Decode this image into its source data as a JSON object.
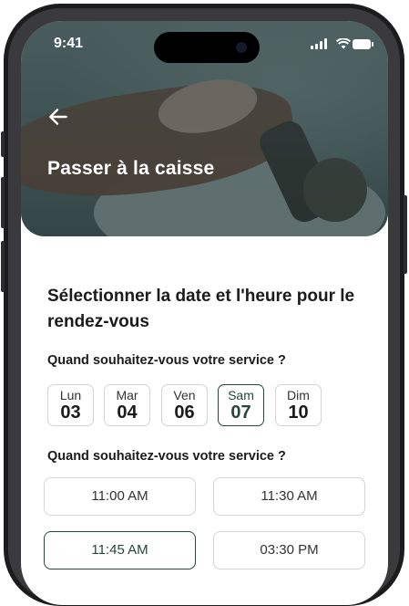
{
  "status_bar": {
    "time": "9:41"
  },
  "header": {
    "title": "Passer à la caisse"
  },
  "main": {
    "title": "Sélectionner la date et l'heure pour le rendez-vous",
    "date_question": "Quand souhaitez-vous votre service ?",
    "days": [
      {
        "name": "Lun",
        "num": "03",
        "selected": false
      },
      {
        "name": "Mar",
        "num": "04",
        "selected": false
      },
      {
        "name": "Ven",
        "num": "06",
        "selected": false
      },
      {
        "name": "Sam",
        "num": "07",
        "selected": true
      },
      {
        "name": "Dim",
        "num": "10",
        "selected": false
      }
    ],
    "time_question": "Quand souhaitez-vous votre service ?",
    "slots": [
      {
        "label": "11:00 AM",
        "selected": false
      },
      {
        "label": "11:30 AM",
        "selected": false
      },
      {
        "label": "11:45 AM",
        "selected": true
      },
      {
        "label": "03:30 PM",
        "selected": false
      }
    ]
  },
  "colors": {
    "accent": "#23473a",
    "border": "#d4d4d4",
    "text": "#1b1b1b"
  },
  "icons": {
    "back": "arrow-left-icon",
    "signal": "signal-icon",
    "wifi": "wifi-icon",
    "battery": "battery-icon"
  }
}
